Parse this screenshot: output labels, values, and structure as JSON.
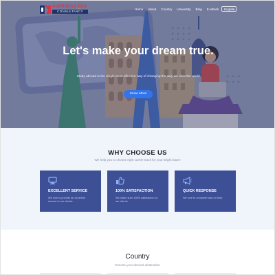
{
  "brand": {
    "name": "OVERSEAS EDU",
    "sub": "CONSULTANCY"
  },
  "nav": {
    "items": [
      "Home",
      "About",
      "Country",
      "University",
      "Blog",
      "E-eBook"
    ],
    "language": "English"
  },
  "hero": {
    "title": "Let's make your dream true.",
    "subtitle": "Study abroad is the single most effective way of changing the way we view the world",
    "button": "Know More"
  },
  "why": {
    "title": "WHY CHOOSE US",
    "subtitle": "We help you to choose right career track for your bright future",
    "cards": [
      {
        "icon": "monitor-icon",
        "title": "EXCELLENT SERVICE",
        "desc": "We love to provide an excellent service to our clients."
      },
      {
        "icon": "thumbs-up-icon",
        "title": "100% SATISFACTION",
        "desc": "We make sure 100% satisfaction of our clients."
      },
      {
        "icon": "megaphone-icon",
        "title": "QUICK RESPONSE",
        "desc": "We love to complete task on time."
      }
    ]
  },
  "country": {
    "title": "Country",
    "subtitle": "Choose your desired destination"
  },
  "colors": {
    "accent": "#3374ec",
    "card": "#3d4f95",
    "section_bg": "#f0f4fb"
  }
}
